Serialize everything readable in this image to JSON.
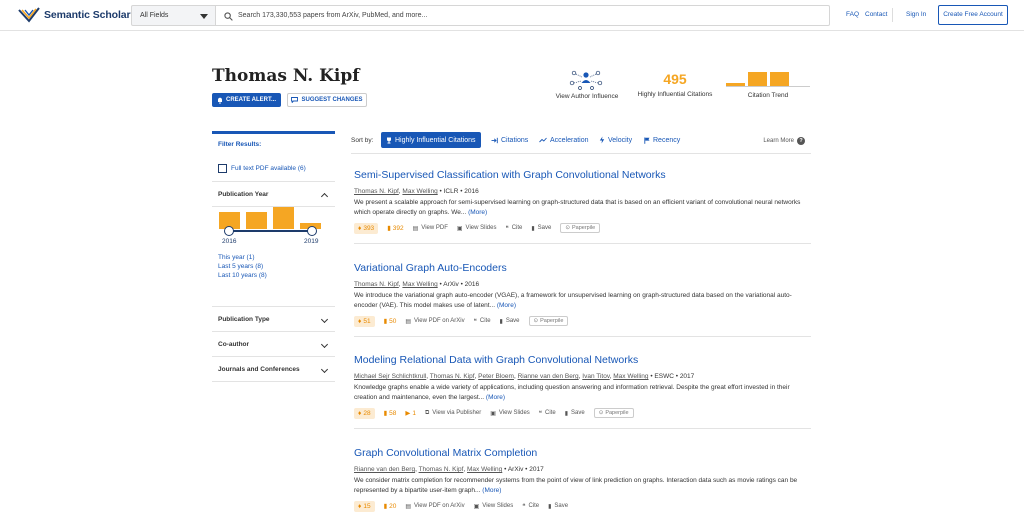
{
  "nav": {
    "logo_text": "Semantic Scholar",
    "fields_label": "All Fields",
    "search_placeholder": "Search 173,330,553 papers from ArXiv, PubMed, and more...",
    "faq": "FAQ",
    "contact": "Contact",
    "sign_in": "Sign In",
    "create_account": "Create Free Account"
  },
  "author": {
    "name": "Thomas N. Kipf",
    "create_alert": "CREATE ALERT...",
    "suggest_changes": "SUGGEST CHANGES"
  },
  "stats": {
    "influence_label": "View Author Influence",
    "influential_citations_value": "495",
    "influential_citations_label": "Highly Influential Citations",
    "trend_label": "Citation Trend",
    "trend_bars_relative": [
      0.15,
      0.8,
      0.85
    ]
  },
  "sidebar": {
    "filter_title": "Filter Results:",
    "full_text": "Full text PDF available (6)",
    "publication_year": "Publication Year",
    "year_hist_relative": [
      0.75,
      0.75,
      1.0,
      0.25
    ],
    "year_start": "2016",
    "year_end": "2019",
    "ranges": [
      "This year (1)",
      "Last 5 years (8)",
      "Last 10 years (8)"
    ],
    "sections": [
      "Publication Type",
      "Co-author",
      "Journals and Conferences"
    ]
  },
  "sort": {
    "label": "Sort by:",
    "options": [
      "Highly Influential Citations",
      "Citations",
      "Acceleration",
      "Velocity",
      "Recency"
    ],
    "learn_more": "Learn More"
  },
  "papers": [
    {
      "title": "Semi-Supervised Classification with Graph Convolutional Networks",
      "authors": [
        "Thomas N. Kipf",
        "Max Welling"
      ],
      "venue": "ICLR",
      "year": "2016",
      "abstract": "We present a scalable approach for semi-supervised learning on graph-structured data that is based on an efficient variant of convolutional neural networks which operate directly on graphs. We...",
      "more": "(More)",
      "influential": "393",
      "citations": "392",
      "pdf_label": "View PDF",
      "slides_label": "View Slides",
      "cite_label": "Cite",
      "save_label": "Save",
      "paperpile": "Paperpile"
    },
    {
      "title": "Variational Graph Auto-Encoders",
      "authors": [
        "Thomas N. Kipf",
        "Max Welling"
      ],
      "venue": "ArXiv",
      "year": "2016",
      "abstract": "We introduce the variational graph auto-encoder (VGAE), a framework for unsupervised learning on graph-structured data based on the variational auto-encoder (VAE). This model makes use of latent...",
      "more": "(More)",
      "influential": "51",
      "citations": "50",
      "pdf_label": "View PDF on ArXiv",
      "cite_label": "Cite",
      "save_label": "Save",
      "paperpile": "Paperpile"
    },
    {
      "title": "Modeling Relational Data with Graph Convolutional Networks",
      "authors": [
        "Michael Sejr Schlichtkrull",
        "Thomas N. Kipf",
        "Peter Bloem",
        "Rianne van den Berg",
        "Ivan Titov",
        "Max Welling"
      ],
      "venue": "ESWC",
      "year": "2017",
      "abstract": "Knowledge graphs enable a wide variety of applications, including question answering and information retrieval. Despite the great effort invested in their creation and maintenance, even the largest...",
      "more": "(More)",
      "influential": "28",
      "citations": "58",
      "videos": "1",
      "pdf_label": "View via Publisher",
      "slides_label": "View Slides",
      "cite_label": "Cite",
      "save_label": "Save",
      "paperpile": "Paperpile"
    },
    {
      "title": "Graph Convolutional Matrix Completion",
      "authors": [
        "Rianne van den Berg",
        "Thomas N. Kipf",
        "Max Welling"
      ],
      "venue": "ArXiv",
      "year": "2017",
      "abstract": "We consider matrix completion for recommender systems from the point of view of link prediction on graphs. Interaction data such as movie ratings can be represented by a bipartite user-item graph...",
      "more": "(More)",
      "influential": "15",
      "citations": "20",
      "pdf_label": "View PDF on ArXiv",
      "slides_label": "View Slides",
      "cite_label": "Cite",
      "save_label": "Save"
    }
  ],
  "colors": {
    "brand_blue": "#1857b6",
    "navy": "#1d3b6b",
    "accent_orange": "#f5a623"
  }
}
